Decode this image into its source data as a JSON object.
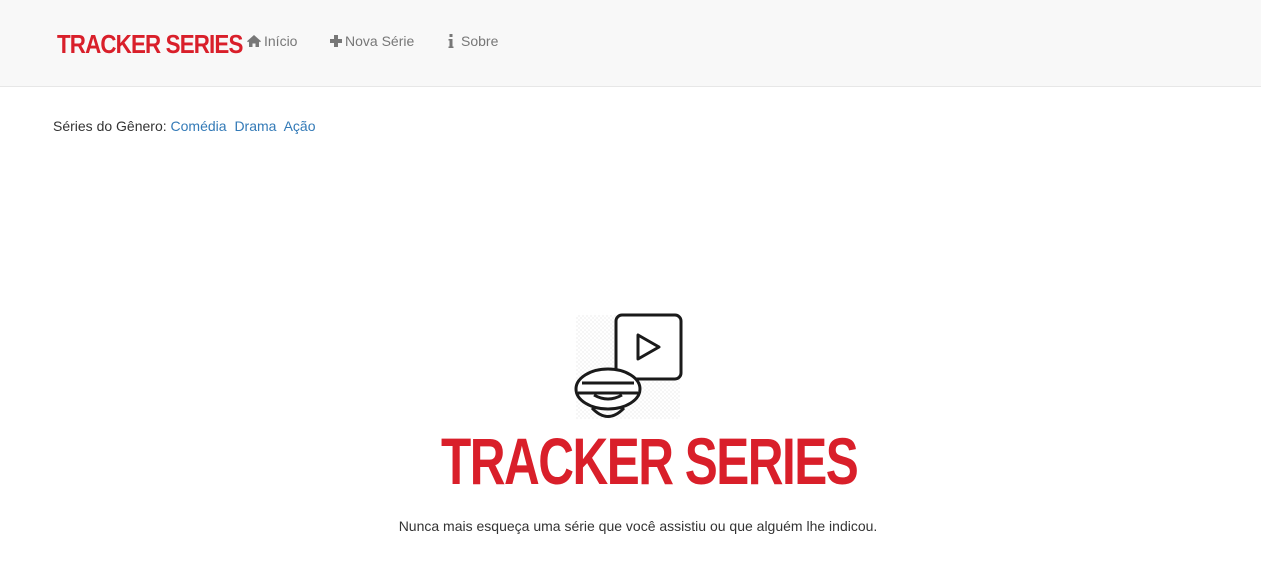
{
  "navbar": {
    "brand_label": "TRACKER SERIES",
    "brand_color": "#d91f2a",
    "items": [
      {
        "label": "Início",
        "icon": "home-icon"
      },
      {
        "label": "Nova Série",
        "icon": "plus-icon"
      },
      {
        "label": "Sobre",
        "icon": "info-icon"
      }
    ]
  },
  "genres": {
    "prefix": "Séries do Gênero:",
    "items": [
      "Comédia",
      "Drama",
      "Ação"
    ],
    "link_color": "#337ab7"
  },
  "hero": {
    "logo_icon": "vr-headset-play-icon",
    "title": "TRACKER SERIES",
    "tagline": "Nunca mais esqueça uma série que você assistiu ou que alguém lhe indicou."
  }
}
